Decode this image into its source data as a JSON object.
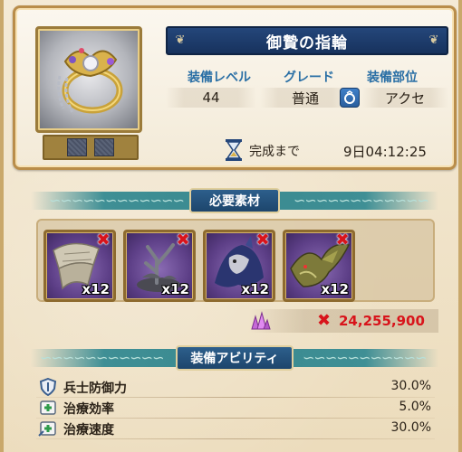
{
  "item": {
    "title": "御贄の指輪",
    "stats": [
      {
        "label": "装備レベル",
        "value": "44"
      },
      {
        "label": "グレード",
        "value": "普通"
      },
      {
        "label": "装備部位",
        "value": "アクセ"
      }
    ],
    "slot_icon": "ring-slot-icon",
    "timer_label": "完成まで",
    "timer_value": "9日04:12:25"
  },
  "materials": {
    "header": "必要素材",
    "items": [
      {
        "name": "cloth-material-icon",
        "count": "x12"
      },
      {
        "name": "dead-tree-material-icon",
        "count": "x12"
      },
      {
        "name": "dark-beast-material-icon",
        "count": "x12"
      },
      {
        "name": "dragon-material-icon",
        "count": "x12"
      }
    ],
    "cost_icon": "crystal-icon",
    "cost_value": "24,255,900"
  },
  "abilities": {
    "header": "装備アビリティ",
    "rows": [
      {
        "icon": "shield-icon",
        "label": "兵士防御力",
        "value": "30.0%"
      },
      {
        "icon": "heal-efficiency-icon",
        "label": "治療効率",
        "value": "5.0%"
      },
      {
        "icon": "heal-speed-icon",
        "label": "治療速度",
        "value": "30.0%"
      }
    ]
  },
  "colors": {
    "title_bar": "#1d3d6c",
    "stat_label": "#2a6fa5",
    "missing": "#d8141b",
    "section_band": "#3a8a90"
  }
}
